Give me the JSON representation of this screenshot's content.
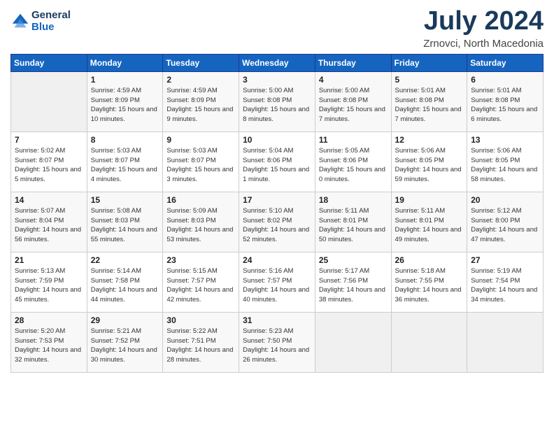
{
  "header": {
    "logo_line1": "General",
    "logo_line2": "Blue",
    "month": "July 2024",
    "location": "Zrnovci, North Macedonia"
  },
  "weekdays": [
    "Sunday",
    "Monday",
    "Tuesday",
    "Wednesday",
    "Thursday",
    "Friday",
    "Saturday"
  ],
  "weeks": [
    [
      {
        "day": "",
        "sunrise": "",
        "sunset": "",
        "daylight": ""
      },
      {
        "day": "1",
        "sunrise": "Sunrise: 4:59 AM",
        "sunset": "Sunset: 8:09 PM",
        "daylight": "Daylight: 15 hours and 10 minutes."
      },
      {
        "day": "2",
        "sunrise": "Sunrise: 4:59 AM",
        "sunset": "Sunset: 8:09 PM",
        "daylight": "Daylight: 15 hours and 9 minutes."
      },
      {
        "day": "3",
        "sunrise": "Sunrise: 5:00 AM",
        "sunset": "Sunset: 8:08 PM",
        "daylight": "Daylight: 15 hours and 8 minutes."
      },
      {
        "day": "4",
        "sunrise": "Sunrise: 5:00 AM",
        "sunset": "Sunset: 8:08 PM",
        "daylight": "Daylight: 15 hours and 7 minutes."
      },
      {
        "day": "5",
        "sunrise": "Sunrise: 5:01 AM",
        "sunset": "Sunset: 8:08 PM",
        "daylight": "Daylight: 15 hours and 7 minutes."
      },
      {
        "day": "6",
        "sunrise": "Sunrise: 5:01 AM",
        "sunset": "Sunset: 8:08 PM",
        "daylight": "Daylight: 15 hours and 6 minutes."
      }
    ],
    [
      {
        "day": "7",
        "sunrise": "Sunrise: 5:02 AM",
        "sunset": "Sunset: 8:07 PM",
        "daylight": "Daylight: 15 hours and 5 minutes."
      },
      {
        "day": "8",
        "sunrise": "Sunrise: 5:03 AM",
        "sunset": "Sunset: 8:07 PM",
        "daylight": "Daylight: 15 hours and 4 minutes."
      },
      {
        "day": "9",
        "sunrise": "Sunrise: 5:03 AM",
        "sunset": "Sunset: 8:07 PM",
        "daylight": "Daylight: 15 hours and 3 minutes."
      },
      {
        "day": "10",
        "sunrise": "Sunrise: 5:04 AM",
        "sunset": "Sunset: 8:06 PM",
        "daylight": "Daylight: 15 hours and 1 minute."
      },
      {
        "day": "11",
        "sunrise": "Sunrise: 5:05 AM",
        "sunset": "Sunset: 8:06 PM",
        "daylight": "Daylight: 15 hours and 0 minutes."
      },
      {
        "day": "12",
        "sunrise": "Sunrise: 5:06 AM",
        "sunset": "Sunset: 8:05 PM",
        "daylight": "Daylight: 14 hours and 59 minutes."
      },
      {
        "day": "13",
        "sunrise": "Sunrise: 5:06 AM",
        "sunset": "Sunset: 8:05 PM",
        "daylight": "Daylight: 14 hours and 58 minutes."
      }
    ],
    [
      {
        "day": "14",
        "sunrise": "Sunrise: 5:07 AM",
        "sunset": "Sunset: 8:04 PM",
        "daylight": "Daylight: 14 hours and 56 minutes."
      },
      {
        "day": "15",
        "sunrise": "Sunrise: 5:08 AM",
        "sunset": "Sunset: 8:03 PM",
        "daylight": "Daylight: 14 hours and 55 minutes."
      },
      {
        "day": "16",
        "sunrise": "Sunrise: 5:09 AM",
        "sunset": "Sunset: 8:03 PM",
        "daylight": "Daylight: 14 hours and 53 minutes."
      },
      {
        "day": "17",
        "sunrise": "Sunrise: 5:10 AM",
        "sunset": "Sunset: 8:02 PM",
        "daylight": "Daylight: 14 hours and 52 minutes."
      },
      {
        "day": "18",
        "sunrise": "Sunrise: 5:11 AM",
        "sunset": "Sunset: 8:01 PM",
        "daylight": "Daylight: 14 hours and 50 minutes."
      },
      {
        "day": "19",
        "sunrise": "Sunrise: 5:11 AM",
        "sunset": "Sunset: 8:01 PM",
        "daylight": "Daylight: 14 hours and 49 minutes."
      },
      {
        "day": "20",
        "sunrise": "Sunrise: 5:12 AM",
        "sunset": "Sunset: 8:00 PM",
        "daylight": "Daylight: 14 hours and 47 minutes."
      }
    ],
    [
      {
        "day": "21",
        "sunrise": "Sunrise: 5:13 AM",
        "sunset": "Sunset: 7:59 PM",
        "daylight": "Daylight: 14 hours and 45 minutes."
      },
      {
        "day": "22",
        "sunrise": "Sunrise: 5:14 AM",
        "sunset": "Sunset: 7:58 PM",
        "daylight": "Daylight: 14 hours and 44 minutes."
      },
      {
        "day": "23",
        "sunrise": "Sunrise: 5:15 AM",
        "sunset": "Sunset: 7:57 PM",
        "daylight": "Daylight: 14 hours and 42 minutes."
      },
      {
        "day": "24",
        "sunrise": "Sunrise: 5:16 AM",
        "sunset": "Sunset: 7:57 PM",
        "daylight": "Daylight: 14 hours and 40 minutes."
      },
      {
        "day": "25",
        "sunrise": "Sunrise: 5:17 AM",
        "sunset": "Sunset: 7:56 PM",
        "daylight": "Daylight: 14 hours and 38 minutes."
      },
      {
        "day": "26",
        "sunrise": "Sunrise: 5:18 AM",
        "sunset": "Sunset: 7:55 PM",
        "daylight": "Daylight: 14 hours and 36 minutes."
      },
      {
        "day": "27",
        "sunrise": "Sunrise: 5:19 AM",
        "sunset": "Sunset: 7:54 PM",
        "daylight": "Daylight: 14 hours and 34 minutes."
      }
    ],
    [
      {
        "day": "28",
        "sunrise": "Sunrise: 5:20 AM",
        "sunset": "Sunset: 7:53 PM",
        "daylight": "Daylight: 14 hours and 32 minutes."
      },
      {
        "day": "29",
        "sunrise": "Sunrise: 5:21 AM",
        "sunset": "Sunset: 7:52 PM",
        "daylight": "Daylight: 14 hours and 30 minutes."
      },
      {
        "day": "30",
        "sunrise": "Sunrise: 5:22 AM",
        "sunset": "Sunset: 7:51 PM",
        "daylight": "Daylight: 14 hours and 28 minutes."
      },
      {
        "day": "31",
        "sunrise": "Sunrise: 5:23 AM",
        "sunset": "Sunset: 7:50 PM",
        "daylight": "Daylight: 14 hours and 26 minutes."
      },
      {
        "day": "",
        "sunrise": "",
        "sunset": "",
        "daylight": ""
      },
      {
        "day": "",
        "sunrise": "",
        "sunset": "",
        "daylight": ""
      },
      {
        "day": "",
        "sunrise": "",
        "sunset": "",
        "daylight": ""
      }
    ]
  ]
}
